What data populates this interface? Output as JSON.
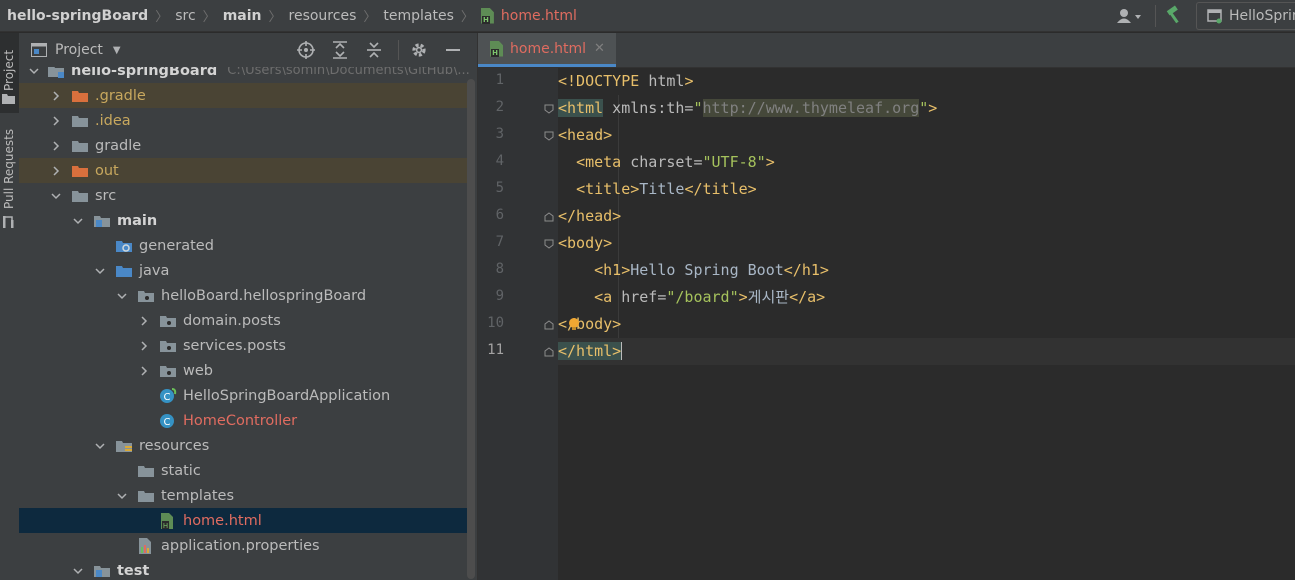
{
  "breadcrumb": [
    "hello-springBoard",
    "src",
    "main",
    "resources",
    "templates",
    "home.html"
  ],
  "toolbar": {
    "run_config": "HelloSpringBoardApplication"
  },
  "sidebar_tabs": [
    "Project",
    "Pull Requests"
  ],
  "project_panel": {
    "title": "Project",
    "root": {
      "label": "hello-springBoard",
      "path": "C:\\Users\\somin\\Documents\\GitHub\\..."
    },
    "items": [
      {
        "label": ".gradle",
        "depth": 1,
        "arrow": "right",
        "kind": "folder-orange",
        "style": "orange",
        "excluded": true
      },
      {
        "label": ".idea",
        "depth": 1,
        "arrow": "right",
        "kind": "folder",
        "style": "orange"
      },
      {
        "label": "gradle",
        "depth": 1,
        "arrow": "right",
        "kind": "folder",
        "style": ""
      },
      {
        "label": "out",
        "depth": 1,
        "arrow": "right",
        "kind": "folder-orange",
        "style": "orange",
        "excluded": true
      },
      {
        "label": "src",
        "depth": 1,
        "arrow": "down",
        "kind": "folder",
        "style": ""
      },
      {
        "label": "main",
        "depth": 2,
        "arrow": "down",
        "kind": "module-folder",
        "style": "bold"
      },
      {
        "label": "generated",
        "depth": 3,
        "arrow": "",
        "kind": "generated-folder",
        "style": ""
      },
      {
        "label": "java",
        "depth": 3,
        "arrow": "down",
        "kind": "source-folder",
        "style": ""
      },
      {
        "label": "helloBoard.hellospringBoard",
        "depth": 4,
        "arrow": "down",
        "kind": "package",
        "style": ""
      },
      {
        "label": "domain.posts",
        "depth": 5,
        "arrow": "right",
        "kind": "package",
        "style": ""
      },
      {
        "label": "services.posts",
        "depth": 5,
        "arrow": "right",
        "kind": "package",
        "style": ""
      },
      {
        "label": "web",
        "depth": 5,
        "arrow": "right",
        "kind": "package",
        "style": ""
      },
      {
        "label": "HelloSpringBoardApplication",
        "depth": 5,
        "arrow": "",
        "kind": "spring-class",
        "style": ""
      },
      {
        "label": "HomeController",
        "depth": 5,
        "arrow": "",
        "kind": "class",
        "style": "red"
      },
      {
        "label": "resources",
        "depth": 3,
        "arrow": "down",
        "kind": "resources-folder",
        "style": ""
      },
      {
        "label": "static",
        "depth": 4,
        "arrow": "",
        "kind": "folder",
        "style": ""
      },
      {
        "label": "templates",
        "depth": 4,
        "arrow": "down",
        "kind": "folder",
        "style": ""
      },
      {
        "label": "home.html",
        "depth": 5,
        "arrow": "",
        "kind": "html-file",
        "style": "red",
        "selected": true
      },
      {
        "label": "application.properties",
        "depth": 4,
        "arrow": "",
        "kind": "properties-file",
        "style": ""
      },
      {
        "label": "test",
        "depth": 2,
        "arrow": "down",
        "kind": "module-folder",
        "style": "bold"
      }
    ]
  },
  "editor": {
    "tab_label": "home.html",
    "current_line": 11,
    "lines": [
      "1",
      "2",
      "3",
      "4",
      "5",
      "6",
      "7",
      "8",
      "9",
      "10",
      "11"
    ]
  },
  "colors": {
    "tag": "#e8bf6a",
    "string": "#a5c25c",
    "error_file": "#e06c60",
    "selection": "#0d293e"
  }
}
